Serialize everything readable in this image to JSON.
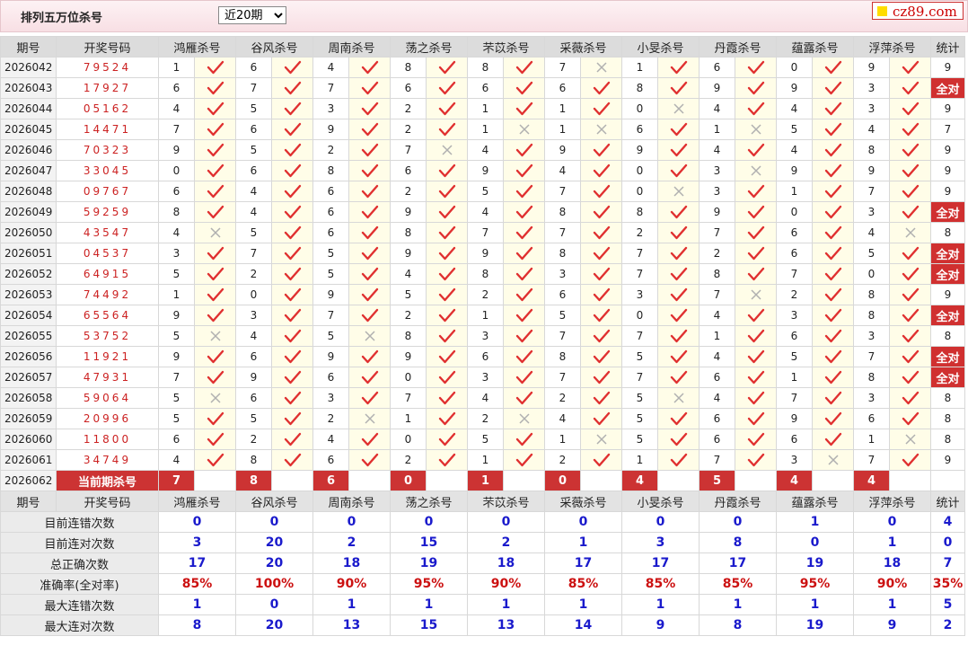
{
  "header": {
    "title": "排列五万位杀号",
    "select_value": "近20期",
    "select_options": [
      "近20期"
    ],
    "logo_text": "cz89.com"
  },
  "columns": {
    "issue": "期号",
    "draw": "开奖号码",
    "experts": [
      "鸿雁杀号",
      "谷风杀号",
      "周南杀号",
      "荡之杀号",
      "芣苡杀号",
      "采薇杀号",
      "小旻杀号",
      "丹霞杀号",
      "蕴露杀号",
      "浮萍杀号"
    ],
    "total": "统计"
  },
  "rows": [
    {
      "issue": "2026042",
      "draw": "79524",
      "kills": [
        1,
        6,
        4,
        8,
        8,
        7,
        1,
        6,
        0,
        9
      ],
      "ok": [
        1,
        1,
        1,
        1,
        1,
        0,
        1,
        1,
        1,
        1
      ],
      "total": "9"
    },
    {
      "issue": "2026043",
      "draw": "17927",
      "kills": [
        6,
        7,
        7,
        6,
        6,
        6,
        8,
        9,
        9,
        3
      ],
      "ok": [
        1,
        1,
        1,
        1,
        1,
        1,
        1,
        1,
        1,
        1
      ],
      "total": "全对"
    },
    {
      "issue": "2026044",
      "draw": "05162",
      "kills": [
        4,
        5,
        3,
        2,
        1,
        1,
        0,
        4,
        4,
        3
      ],
      "ok": [
        1,
        1,
        1,
        1,
        1,
        1,
        0,
        1,
        1,
        1
      ],
      "total": "9"
    },
    {
      "issue": "2026045",
      "draw": "14471",
      "kills": [
        7,
        6,
        9,
        2,
        1,
        1,
        6,
        1,
        5,
        4
      ],
      "ok": [
        1,
        1,
        1,
        1,
        0,
        0,
        1,
        0,
        1,
        1
      ],
      "total": "7"
    },
    {
      "issue": "2026046",
      "draw": "70323",
      "kills": [
        9,
        5,
        2,
        7,
        4,
        9,
        9,
        4,
        4,
        8
      ],
      "ok": [
        1,
        1,
        1,
        0,
        1,
        1,
        1,
        1,
        1,
        1
      ],
      "total": "9"
    },
    {
      "issue": "2026047",
      "draw": "33045",
      "kills": [
        0,
        6,
        8,
        6,
        9,
        4,
        0,
        3,
        9,
        9
      ],
      "ok": [
        1,
        1,
        1,
        1,
        1,
        1,
        1,
        0,
        1,
        1
      ],
      "total": "9"
    },
    {
      "issue": "2026048",
      "draw": "09767",
      "kills": [
        6,
        4,
        6,
        2,
        5,
        7,
        0,
        3,
        1,
        7
      ],
      "ok": [
        1,
        1,
        1,
        1,
        1,
        1,
        0,
        1,
        1,
        1
      ],
      "total": "9"
    },
    {
      "issue": "2026049",
      "draw": "59259",
      "kills": [
        8,
        4,
        6,
        9,
        4,
        8,
        8,
        9,
        0,
        3
      ],
      "ok": [
        1,
        1,
        1,
        1,
        1,
        1,
        1,
        1,
        1,
        1
      ],
      "total": "全对"
    },
    {
      "issue": "2026050",
      "draw": "43547",
      "kills": [
        4,
        5,
        6,
        8,
        7,
        7,
        2,
        7,
        6,
        4
      ],
      "ok": [
        0,
        1,
        1,
        1,
        1,
        1,
        1,
        1,
        1,
        0
      ],
      "total": "8"
    },
    {
      "issue": "2026051",
      "draw": "04537",
      "kills": [
        3,
        7,
        5,
        9,
        9,
        8,
        7,
        2,
        6,
        5
      ],
      "ok": [
        1,
        1,
        1,
        1,
        1,
        1,
        1,
        1,
        1,
        1
      ],
      "total": "全对"
    },
    {
      "issue": "2026052",
      "draw": "64915",
      "kills": [
        5,
        2,
        5,
        4,
        8,
        3,
        7,
        8,
        7,
        0
      ],
      "ok": [
        1,
        1,
        1,
        1,
        1,
        1,
        1,
        1,
        1,
        1
      ],
      "total": "全对"
    },
    {
      "issue": "2026053",
      "draw": "74492",
      "kills": [
        1,
        0,
        9,
        5,
        2,
        6,
        3,
        7,
        2,
        8
      ],
      "ok": [
        1,
        1,
        1,
        1,
        1,
        1,
        1,
        0,
        1,
        1
      ],
      "total": "9"
    },
    {
      "issue": "2026054",
      "draw": "65564",
      "kills": [
        9,
        3,
        7,
        2,
        1,
        5,
        0,
        4,
        3,
        8
      ],
      "ok": [
        1,
        1,
        1,
        1,
        1,
        1,
        1,
        1,
        1,
        1
      ],
      "total": "全对"
    },
    {
      "issue": "2026055",
      "draw": "53752",
      "kills": [
        5,
        4,
        5,
        8,
        3,
        7,
        7,
        1,
        6,
        3
      ],
      "ok": [
        0,
        1,
        0,
        1,
        1,
        1,
        1,
        1,
        1,
        1
      ],
      "total": "8"
    },
    {
      "issue": "2026056",
      "draw": "11921",
      "kills": [
        9,
        6,
        9,
        9,
        6,
        8,
        5,
        4,
        5,
        7
      ],
      "ok": [
        1,
        1,
        1,
        1,
        1,
        1,
        1,
        1,
        1,
        1
      ],
      "total": "全对"
    },
    {
      "issue": "2026057",
      "draw": "47931",
      "kills": [
        7,
        9,
        6,
        0,
        3,
        7,
        7,
        6,
        1,
        8
      ],
      "ok": [
        1,
        1,
        1,
        1,
        1,
        1,
        1,
        1,
        1,
        1
      ],
      "total": "全对"
    },
    {
      "issue": "2026058",
      "draw": "59064",
      "kills": [
        5,
        6,
        3,
        7,
        4,
        2,
        5,
        4,
        7,
        3
      ],
      "ok": [
        0,
        1,
        1,
        1,
        1,
        1,
        0,
        1,
        1,
        1
      ],
      "total": "8"
    },
    {
      "issue": "2026059",
      "draw": "20996",
      "kills": [
        5,
        5,
        2,
        1,
        2,
        4,
        5,
        6,
        9,
        6
      ],
      "ok": [
        1,
        1,
        0,
        1,
        0,
        1,
        1,
        1,
        1,
        1
      ],
      "total": "8"
    },
    {
      "issue": "2026060",
      "draw": "11800",
      "kills": [
        6,
        2,
        4,
        0,
        5,
        1,
        5,
        6,
        6,
        1
      ],
      "ok": [
        1,
        1,
        1,
        1,
        1,
        0,
        1,
        1,
        1,
        0
      ],
      "total": "8"
    },
    {
      "issue": "2026061",
      "draw": "34749",
      "kills": [
        4,
        8,
        6,
        2,
        1,
        2,
        1,
        7,
        3,
        7
      ],
      "ok": [
        1,
        1,
        1,
        1,
        1,
        1,
        1,
        1,
        0,
        1
      ],
      "total": "9"
    }
  ],
  "current": {
    "issue": "2026062",
    "label": "当前期杀号",
    "kills": [
      "7",
      "8",
      "6",
      "0",
      "1",
      "0",
      "4",
      "5",
      "4",
      "4"
    ]
  },
  "stats": [
    {
      "label": "目前连错次数",
      "values": [
        "0",
        "0",
        "0",
        "0",
        "0",
        "0",
        "0",
        "0",
        "1",
        "0",
        "4"
      ],
      "pct": false
    },
    {
      "label": "目前连对次数",
      "values": [
        "3",
        "20",
        "2",
        "15",
        "2",
        "1",
        "3",
        "8",
        "0",
        "1",
        "0"
      ],
      "pct": false
    },
    {
      "label": "总正确次数",
      "values": [
        "17",
        "20",
        "18",
        "19",
        "18",
        "17",
        "17",
        "17",
        "19",
        "18",
        "7"
      ],
      "pct": false
    },
    {
      "label": "准确率(全对率)",
      "values": [
        "85%",
        "100%",
        "90%",
        "95%",
        "90%",
        "85%",
        "85%",
        "85%",
        "95%",
        "90%",
        "35%"
      ],
      "pct": true
    },
    {
      "label": "最大连错次数",
      "values": [
        "1",
        "0",
        "1",
        "1",
        "1",
        "1",
        "1",
        "1",
        "1",
        "1",
        "5"
      ],
      "pct": false
    },
    {
      "label": "最大连对次数",
      "values": [
        "8",
        "20",
        "13",
        "15",
        "13",
        "14",
        "9",
        "8",
        "19",
        "9",
        "2"
      ],
      "pct": false
    }
  ],
  "icons": {
    "correct": "check-icon",
    "wrong": "cross-icon"
  },
  "colors": {
    "check": "#e03030",
    "cross": "#b0b0b0",
    "highlight": "#d03030",
    "stat": "#1a1acc"
  }
}
